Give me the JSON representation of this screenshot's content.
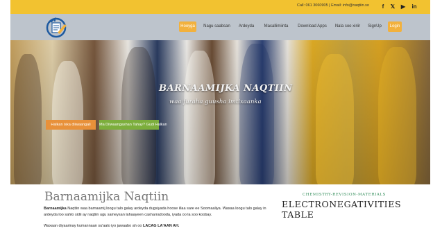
{
  "topbar": {
    "contact": "Call: 061 3060905 | Email: info@naqtiin.so",
    "social": [
      {
        "icon": "facebook-icon",
        "glyph": "f"
      },
      {
        "icon": "twitter-icon",
        "glyph": "𝕏"
      },
      {
        "icon": "youtube-icon",
        "glyph": "▶"
      },
      {
        "icon": "linkedin-icon",
        "glyph": "in"
      }
    ]
  },
  "nav": {
    "items": [
      "Hooyga",
      "Nagu saabsan",
      "Ardeyda",
      "Macallimiinta",
      "Download Apps",
      "Nala soo xiriir",
      "SignUp",
      "Login"
    ]
  },
  "hero": {
    "title": "BARNAAMIJKA NAQTIIN",
    "subtitle": "waa furaha guusha imtixaanka",
    "btn_primary": "Halkan iska diiwaangali",
    "btn_secondary": "Ma Diiwaangashan Tahay? Gudi Halkan"
  },
  "content": {
    "title": "Barnaamijka Naqtiin",
    "para1_bold": "Barnaamijka",
    "para1_rest": " Naqtiin waa barnaamij loogu talo galay ardeyda dugsiyada hoose illaa sare ee Soomaaliya. Waxaa loogu talo galay in ardeyda loo sahlo sidii ay naqtiin ugu sameysan lahaayeen casharradooda, iyada oo la soo koobay.",
    "para2_rest": "Waxaan diyaarinay kumannaan su'aalo iyo jawaabo ah oo ",
    "para2_bold": "LACAG LA'AAN AH."
  },
  "sidebar": {
    "category": "CHEMISTRY-REVISION-MATERIALS",
    "title": "ELECTRONEGATIVITIES TABLE"
  },
  "colors": {
    "topbar": "#f2c230",
    "header": "#bdc4cc",
    "accent_orange": "#f2b13d",
    "btn_orange": "#e8913a",
    "btn_green": "#7cae3c",
    "category_green": "#2e8b57"
  }
}
